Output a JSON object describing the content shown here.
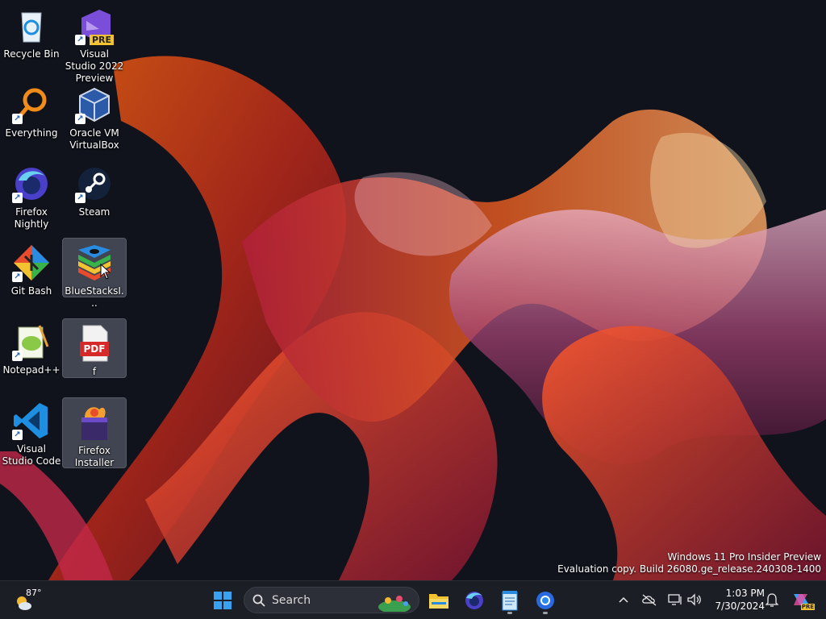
{
  "desktop": {
    "icons": [
      {
        "label": "Recycle Bin",
        "icon": "recycle-bin-icon"
      },
      {
        "label": "Visual Studio 2022 Preview",
        "icon": "visual-studio-preview-icon",
        "badge": "PRE"
      },
      {
        "label": "Everything",
        "icon": "magnifier-icon"
      },
      {
        "label": "Oracle VM VirtualBox",
        "icon": "virtualbox-cube-icon"
      },
      {
        "label": "Firefox Nightly",
        "icon": "firefox-nightly-icon"
      },
      {
        "label": "Steam",
        "icon": "steam-icon"
      },
      {
        "label": "Git Bash",
        "icon": "git-bash-icon"
      },
      {
        "label": "BlueStacksI...",
        "icon": "bluestacks-icon"
      },
      {
        "label": "Notepad++",
        "icon": "notepad-plus-plus-icon"
      },
      {
        "label": "f",
        "icon": "pdf-file-icon",
        "badge": "PDF"
      },
      {
        "label": "Visual Studio Code",
        "icon": "vscode-icon"
      },
      {
        "label": "Firefox Installer",
        "icon": "firefox-installer-icon"
      }
    ]
  },
  "watermark": {
    "line1": "Windows 11 Pro Insider Preview",
    "line2": "Evaluation copy. Build 26080.ge_release.240308-1400"
  },
  "taskbar": {
    "weather_temp": "87°",
    "search_placeholder": "Search",
    "pinned": [
      "start-button",
      "search",
      "file-explorer",
      "firefox",
      "notepad",
      "chrome"
    ],
    "clock_time": "1:03 PM",
    "clock_date": "7/30/2024",
    "copilot_badge": "PRE"
  },
  "colors": {
    "accent": "#0078d4",
    "taskbar_bg": "#1c1e26"
  }
}
